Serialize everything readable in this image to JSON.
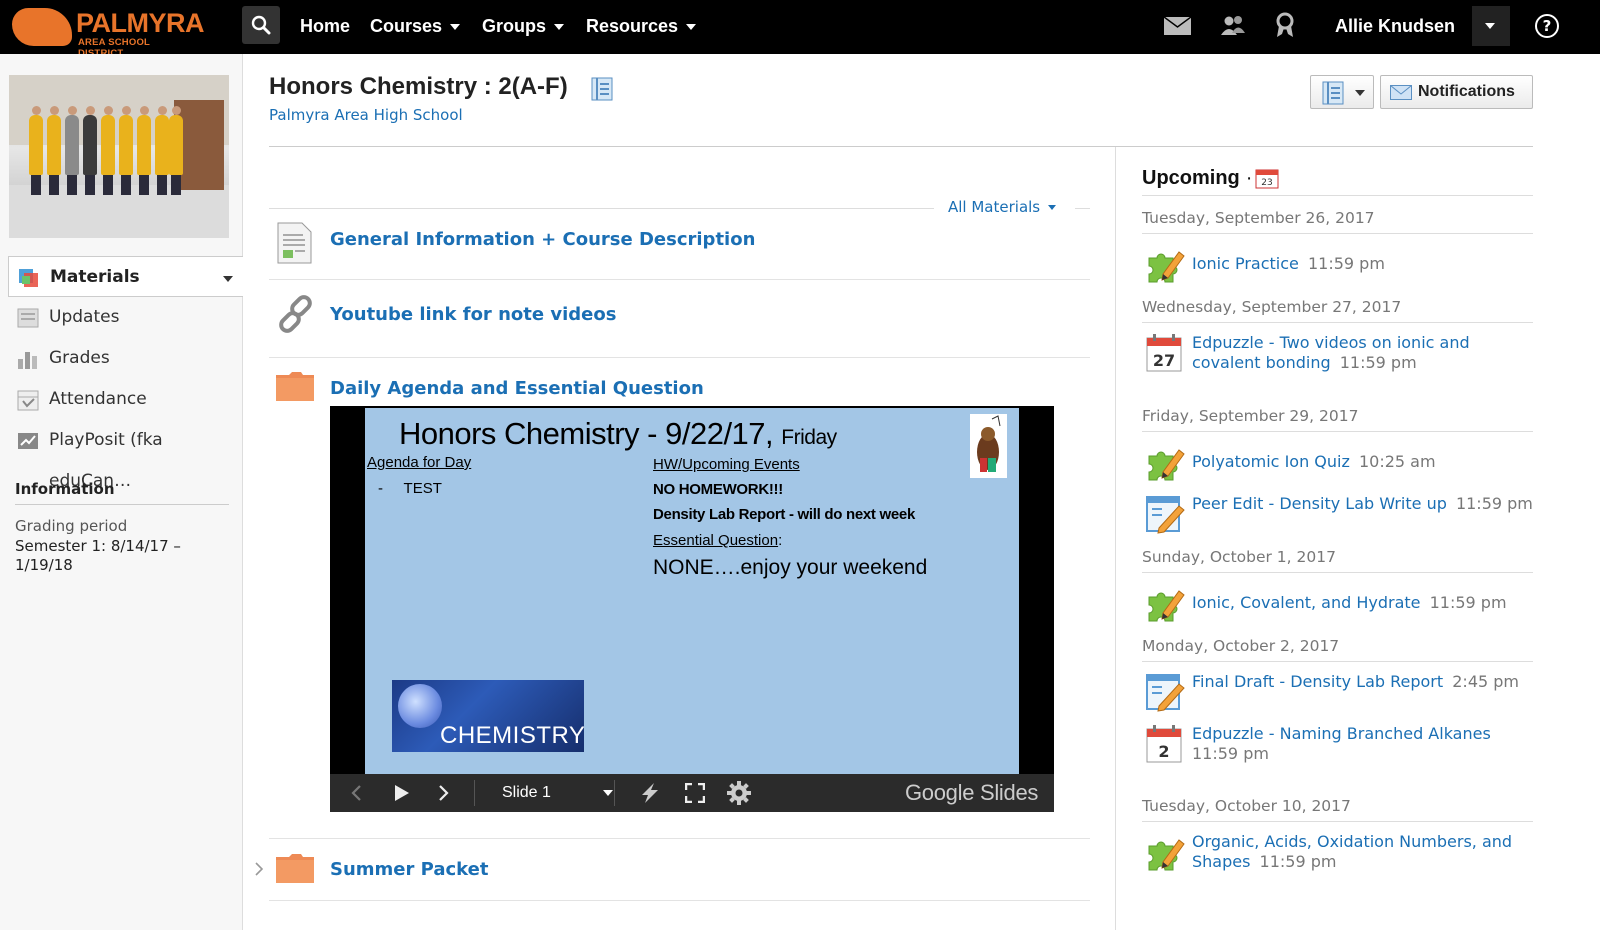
{
  "topbar": {
    "logo_line1": "PALMYRA",
    "logo_line2": "AREA SCHOOL DISTRICT",
    "nav": [
      "Home",
      "Courses",
      "Groups",
      "Resources"
    ],
    "user_name": "Allie Knudsen",
    "help": "?"
  },
  "sidebar": {
    "items": [
      {
        "label": "Materials",
        "icon": "materials-icon",
        "active": true
      },
      {
        "label": "Updates",
        "icon": "updates-icon"
      },
      {
        "label": "Grades",
        "icon": "grades-icon"
      },
      {
        "label": "Attendance",
        "icon": "attendance-icon"
      },
      {
        "label": "PlayPosit (fka eduCan…",
        "icon": "playposit-icon"
      }
    ],
    "info_header": "Information",
    "grading_label": "Grading period",
    "grading_value": "Semester 1: 8/14/17 – 1/19/18"
  },
  "course": {
    "title": "Honors Chemistry : 2(A-F)",
    "school": "Palmyra Area High School",
    "notifications_label": "Notifications",
    "filter_label": "All Materials"
  },
  "materials": [
    {
      "label": "General Information + Course Description",
      "icon": "document-icon"
    },
    {
      "label": "Youtube link for note videos",
      "icon": "link-icon"
    },
    {
      "label": "Daily Agenda and Essential Question",
      "icon": "folder-icon"
    },
    {
      "label": "Summer Packet",
      "icon": "folder-icon"
    }
  ],
  "slide": {
    "title": "Honors Chemistry - 9/22/17,",
    "title_day": "Friday",
    "agenda_header": "Agenda for Day",
    "agenda_item": "-     TEST",
    "hw_header": "HW/Upcoming Events",
    "hw_line1": "NO HOMEWORK!!!",
    "hw_line2": "Density Lab Report - will do next week",
    "eq_header": "Essential Question",
    "eq_colon": ":",
    "eq_text": "NONE….enjoy your weekend",
    "image_word": "CHEMISTRY",
    "slide_selector": "Slide 1",
    "brand": "Google Slides"
  },
  "upcoming": {
    "header": "Upcoming",
    "sep": "·",
    "calendar_day": "23",
    "days": [
      {
        "date": "Tuesday, September 26, 2017",
        "events": [
          {
            "title": "Ionic Practice",
            "time": "11:59 pm",
            "icon": "assignment-icon"
          }
        ]
      },
      {
        "date": "Wednesday, September 27, 2017",
        "events": [
          {
            "title": "Edpuzzle - Two videos on ionic and covalent bonding",
            "time": "11:59 pm",
            "icon": "calendar-event-icon",
            "badge": "27"
          }
        ]
      },
      {
        "date": "Friday, September 29, 2017",
        "events": [
          {
            "title": "Polyatomic Ion Quiz",
            "time": "10:25 am",
            "icon": "assignment-icon"
          },
          {
            "title": "Peer Edit - Density Lab Write up",
            "time": "11:59 pm",
            "icon": "discussion-icon"
          }
        ]
      },
      {
        "date": "Sunday, October 1, 2017",
        "events": [
          {
            "title": "Ionic, Covalent, and Hydrate",
            "time": "11:59 pm",
            "icon": "assignment-icon"
          }
        ]
      },
      {
        "date": "Monday, October 2, 2017",
        "events": [
          {
            "title": "Final Draft - Density Lab Report",
            "time": "2:45 pm",
            "icon": "discussion-icon"
          },
          {
            "title": "Edpuzzle - Naming Branched Alkanes",
            "time": "11:59 pm",
            "icon": "calendar-event-icon",
            "badge": "2"
          }
        ]
      },
      {
        "date": "Tuesday, October 10, 2017",
        "events": [
          {
            "title": "Organic, Acids, Oxidation Numbers, and Shapes",
            "time": "11:59 pm",
            "icon": "assignment-icon"
          }
        ]
      }
    ]
  },
  "colors": {
    "brand_orange": "#e8742a",
    "link_blue": "#1b6fb4",
    "slide_bg": "#a3c6e6",
    "topbar": "#000000"
  }
}
